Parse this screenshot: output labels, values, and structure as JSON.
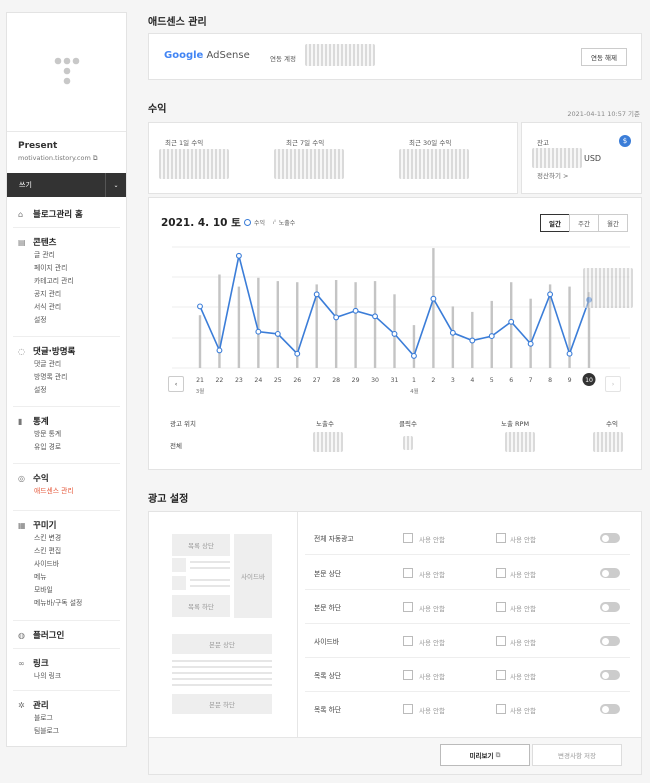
{
  "sidebar": {
    "blog_name": "Present",
    "blog_url": "motivation.tistory.com",
    "write_label": "쓰기",
    "sections": [
      {
        "title": "블로그관리 홈",
        "icon": "home-icon",
        "items": []
      },
      {
        "title": "콘텐츠",
        "icon": "document-icon",
        "items": [
          "글 관리",
          "페이지 관리",
          "카테고리 관리",
          "공지 관리",
          "서식 관리",
          "설정"
        ]
      },
      {
        "title": "댓글·방명록",
        "icon": "comment-icon",
        "items": [
          "댓글 관리",
          "방명록 관리",
          "설정"
        ]
      },
      {
        "title": "통계",
        "icon": "chart-icon",
        "items": [
          "방문 통계",
          "유입 경로"
        ]
      },
      {
        "title": "수익",
        "icon": "coin-icon",
        "items": [
          "애드센스 관리"
        ]
      },
      {
        "title": "꾸미기",
        "icon": "palette-icon",
        "items": [
          "스킨 변경",
          "스킨 편집",
          "사이드바",
          "메뉴",
          "모바일",
          "메뉴바/구독 설정"
        ]
      },
      {
        "title": "플러그인",
        "icon": "plugin-icon",
        "items": []
      },
      {
        "title": "링크",
        "icon": "link-icon",
        "items": [
          "나의 링크"
        ]
      },
      {
        "title": "관리",
        "icon": "gear-icon",
        "items": [
          "블로그",
          "팀블로그"
        ]
      }
    ],
    "active_item": "애드센스 관리"
  },
  "adsense": {
    "heading": "애드센스 관리",
    "logo_google": "Google",
    "logo_adsense": "AdSense",
    "account_label": "연동 계정",
    "unlink_label": "연동 해제"
  },
  "revenue": {
    "heading": "수익",
    "timestamp": "2021-04-11 10:57 기준",
    "periods": [
      "최근 1일 수익",
      "최근 7일 수익",
      "최근 30일 수익"
    ],
    "balance_label": "잔고",
    "currency": "USD",
    "settle_label": "정산하기 >",
    "dollar_badge": "$"
  },
  "chart_card": {
    "date": "2021. 4. 10 토",
    "legend_revenue": "수익",
    "legend_impressions": "노출수",
    "tabs": [
      "일간",
      "주간",
      "월간"
    ],
    "active_tab": "일간",
    "month_march": "3월",
    "month_april": "4월",
    "table_headers": [
      "광고 위치",
      "노출수",
      "클릭수",
      "노출 RPM",
      "수익"
    ],
    "table_row_label": "전체",
    "colors": {
      "line": "#3b7dd8",
      "bar": "#c4c4c4"
    }
  },
  "chart_data": {
    "type": "line",
    "x": [
      "21",
      "22",
      "23",
      "24",
      "25",
      "26",
      "27",
      "28",
      "29",
      "30",
      "31",
      "1",
      "2",
      "3",
      "4",
      "5",
      "6",
      "7",
      "8",
      "9",
      "10"
    ],
    "series": [
      {
        "name": "수익",
        "values": [
          5.6,
          1.6,
          10.2,
          3.3,
          3.1,
          1.3,
          6.7,
          4.6,
          5.2,
          4.7,
          3.1,
          1.1,
          6.3,
          3.2,
          2.5,
          2.9,
          4.2,
          2.2,
          6.7,
          1.3,
          6.2
        ]
      },
      {
        "name": "노출수",
        "values": [
          4.8,
          8.5,
          7.4,
          8.2,
          7.9,
          7.8,
          7.6,
          8.0,
          7.8,
          7.9,
          6.7,
          3.9,
          10.9,
          5.6,
          5.1,
          6.1,
          7.8,
          6.3,
          7.6,
          7.4,
          6.9
        ]
      }
    ],
    "grid": true,
    "legend": "top"
  },
  "ad_settings": {
    "heading": "광고 설정",
    "mock_labels": {
      "list_top": "목록 상단",
      "sidebar": "사이드바",
      "list_bottom": "목록 하단",
      "body_top": "본문 상단",
      "body_bottom": "본문 하단"
    },
    "rows": [
      {
        "label": "전체 자동광고",
        "opt1": "사용 안함",
        "opt2": "사용 안함"
      },
      {
        "label": "본문 상단",
        "opt1": "사용 안함",
        "opt2": "사용 안함"
      },
      {
        "label": "본문 하단",
        "opt1": "사용 안함",
        "opt2": "사용 안함"
      },
      {
        "label": "사이드바",
        "opt1": "사용 안함",
        "opt2": "사용 안함"
      },
      {
        "label": "목록 상단",
        "opt1": "사용 안함",
        "opt2": "사용 안함"
      },
      {
        "label": "목록 하단",
        "opt1": "사용 안함",
        "opt2": "사용 안함"
      }
    ],
    "preview_label": "미리보기",
    "save_label": "변경사항 저장"
  }
}
